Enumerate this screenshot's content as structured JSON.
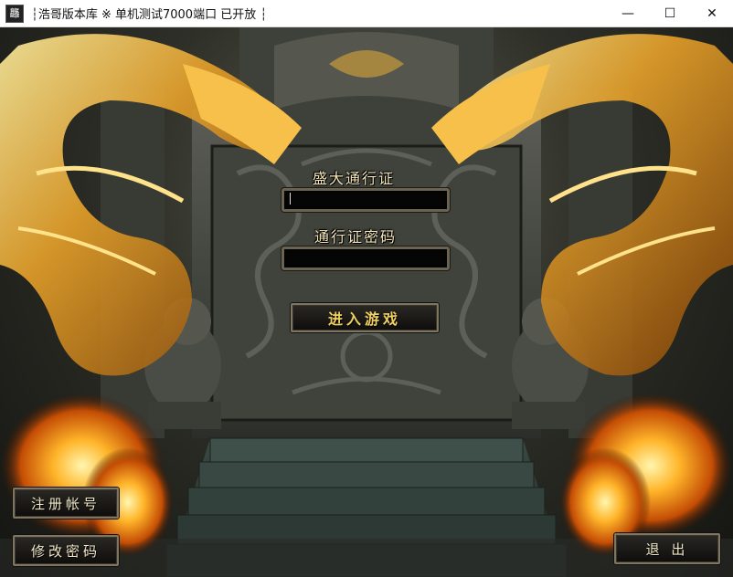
{
  "window": {
    "title": "┆浩哥版本库 ※ 单机测试7000端口 已开放 ┆",
    "icon_glyph": "龘",
    "minimize_glyph": "—",
    "maximize_glyph": "☐",
    "close_glyph": "✕"
  },
  "login": {
    "account_label": "盛大通行证",
    "account_value": "",
    "password_label": "通行证密码",
    "password_value": "",
    "enter_button": "进入游戏"
  },
  "buttons": {
    "register": "注册帐号",
    "change_password": "修改密码",
    "exit": "退 出"
  },
  "colors": {
    "label_text": "#f2e6b8",
    "enter_text": "#f0cf62",
    "flame": "#ff9c1a",
    "stone": "#4b4d45"
  }
}
